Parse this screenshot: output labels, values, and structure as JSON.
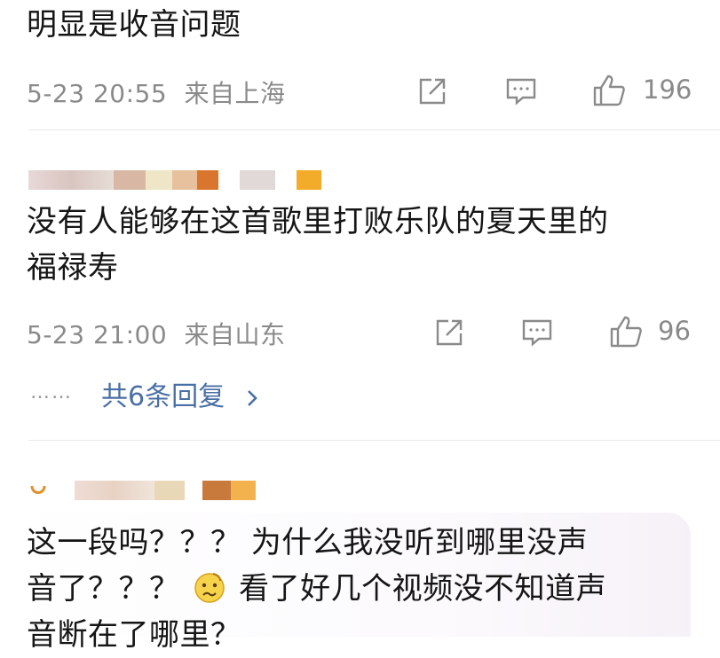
{
  "comments": [
    {
      "text_lines": [
        "明显是收音问题"
      ],
      "date": "5-23 20:55",
      "location": "来自上海",
      "likes": "196",
      "share_icon": "share-icon",
      "comment_icon": "comment-icon",
      "like_icon": "thumbs-up-icon"
    },
    {
      "text_lines": [
        "没有人能够在这首歌里打败乐队的夏天里的",
        "福禄寿"
      ],
      "date": "5-23 21:00",
      "location": "来自山东",
      "likes": "96",
      "share_icon": "share-icon",
      "comment_icon": "comment-icon",
      "like_icon": "thumbs-up-icon",
      "replies_dots": "……",
      "replies_label": "共6条回复"
    },
    {
      "text_lines": [
        "这一段吗？？？ 为什么我没听到哪里没声",
        "音了？？？",
        "看了好几个视频没不知道声",
        "音断在了哪里？"
      ],
      "emoji_icon": "confused-face-emoji-icon"
    }
  ],
  "colors": {
    "text": "#151515",
    "meta": "#8a8a8a",
    "link": "#4a6fa5",
    "divider": "#e9e9e9"
  }
}
